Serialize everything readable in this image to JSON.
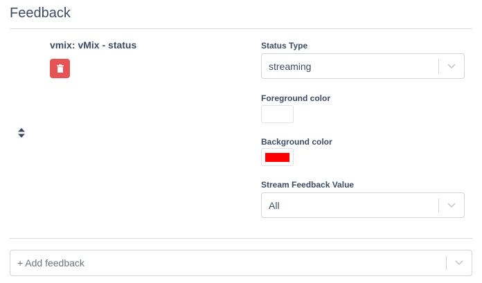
{
  "section": {
    "title": "Feedback"
  },
  "feedback": {
    "name": "vmix: vMix - status",
    "delete_icon": "trash-icon",
    "drag_icon": "sort-icon",
    "fields": {
      "status_type": {
        "label": "Status Type",
        "value": "streaming"
      },
      "foreground_color": {
        "label": "Foreground color",
        "value": "#ffffff"
      },
      "background_color": {
        "label": "Background color",
        "value": "#ff0000"
      },
      "stream_feedback_value": {
        "label": "Stream Feedback Value",
        "value": "All"
      }
    }
  },
  "add_feedback": {
    "placeholder": "+ Add feedback"
  },
  "colors": {
    "text": "#3c4b64",
    "danger": "#e55353",
    "border": "#cfd4da"
  }
}
